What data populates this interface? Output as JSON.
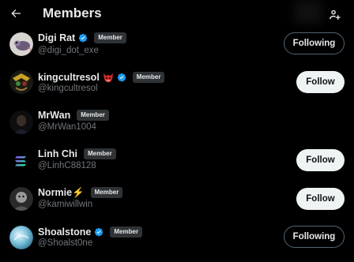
{
  "header": {
    "title": "Members"
  },
  "members": [
    {
      "name": "Digi Rat",
      "handle": "@digi_dot_exe",
      "verified": true,
      "emoji": "",
      "badge": "Member",
      "button": "Following"
    },
    {
      "name": "kingcultresol",
      "handle": "@kingcultresol",
      "verified": true,
      "emoji": "devil-mask",
      "badge": "Member",
      "button": "Follow"
    },
    {
      "name": "MrWan",
      "handle": "@MrWan1004",
      "verified": false,
      "emoji": "",
      "badge": "Member",
      "button": ""
    },
    {
      "name": "Linh Chi",
      "handle": "@LinhC88128",
      "verified": false,
      "emoji": "",
      "badge": "Member",
      "button": "Follow"
    },
    {
      "name": "Normie⚡",
      "handle": "@kamiwillwin",
      "verified": false,
      "emoji": "",
      "badge": "Member",
      "button": "Follow"
    },
    {
      "name": "Shoalstone",
      "handle": "@Shoalst0ne",
      "verified": true,
      "emoji": "",
      "badge": "Member",
      "button": "Following"
    }
  ],
  "colors": {
    "background": "#000000",
    "verified": "#1d9bf0",
    "muted": "#71767b",
    "badge_bg": "#2f3336"
  }
}
